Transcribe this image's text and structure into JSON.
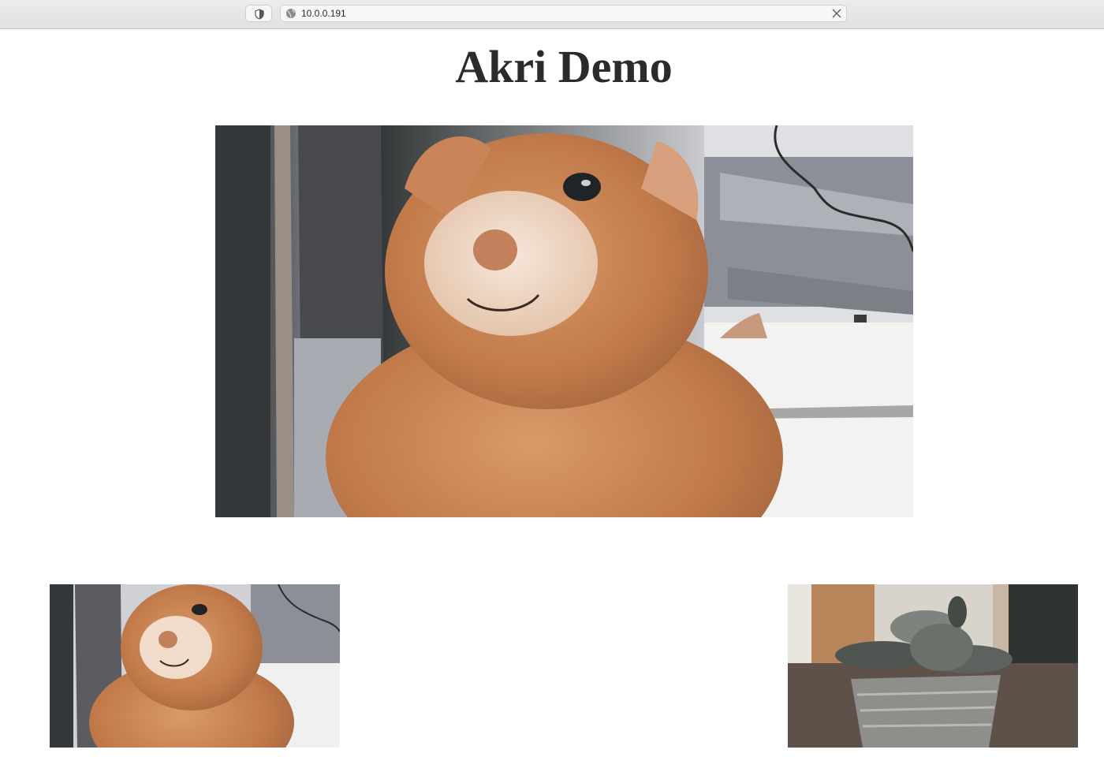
{
  "browser": {
    "url": "10.0.0.191",
    "icons": {
      "site": "globe-icon",
      "tracking": "shield-icon",
      "clear": "close-icon"
    }
  },
  "page": {
    "title": "Akri Demo"
  },
  "feeds": [
    {
      "name": "main-camera-feed",
      "subject": "plush-llama",
      "size": "large"
    },
    {
      "name": "camera-feed-1",
      "subject": "plush-llama",
      "size": "small"
    },
    {
      "name": "camera-feed-2",
      "subject": "potted-plant",
      "size": "small"
    }
  ],
  "colors": {
    "toolbar": "#e6e6e6",
    "title_text": "#2b2b2b",
    "llama_fur": "#c8814f",
    "page_background": "#ffffff"
  }
}
